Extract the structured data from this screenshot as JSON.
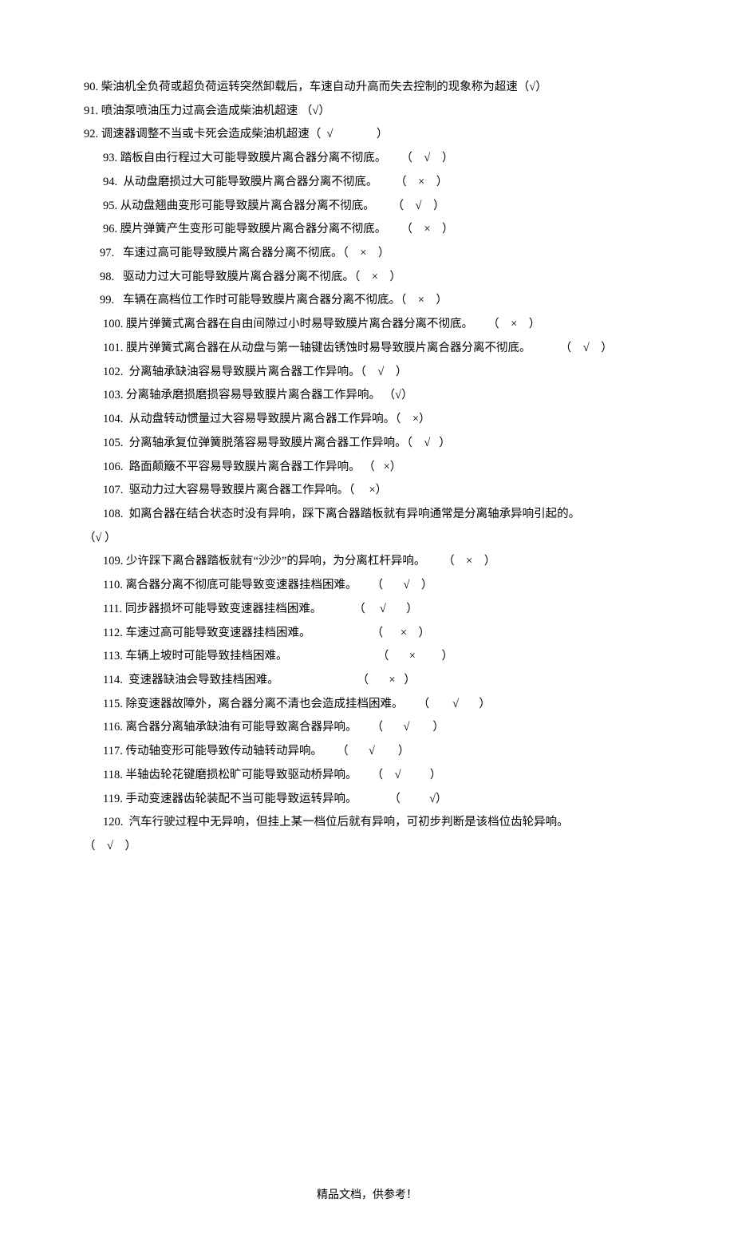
{
  "lines": [
    {
      "cls": "",
      "text": "90. 柴油机全负荷或超负荷运转突然卸载后，车速自动升高而失去控制的现象称为超速（√）"
    },
    {
      "cls": "",
      "text": "91. 喷油泵喷油压力过高会造成柴油机超速 （√）"
    },
    {
      "cls": "",
      "text": "92. 调速器调整不当或卡死会造成柴油机超速（  √               ）"
    },
    {
      "cls": "indent1",
      "text": "93. 踏板自由行程过大可能导致膜片离合器分离不彻底。     （    √    ）"
    },
    {
      "cls": "indent1",
      "text": "94.  从动盘磨损过大可能导致膜片离合器分离不彻底。      （    ×    ）"
    },
    {
      "cls": "indent1",
      "text": "95. 从动盘翘曲变形可能导致膜片离合器分离不彻底。      （    √    ）"
    },
    {
      "cls": "indent1",
      "text": "96. 膜片弹簧产生变形可能导致膜片离合器分离不彻底。     （    ×    ）"
    },
    {
      "cls": "indent2",
      "text": "97.   车速过高可能导致膜片离合器分离不彻底。（    ×    ）"
    },
    {
      "cls": "indent2",
      "text": "98.   驱动力过大可能导致膜片离合器分离不彻底。（    ×    ）"
    },
    {
      "cls": "indent2",
      "text": "99.   车辆在高档位工作时可能导致膜片离合器分离不彻底。（    ×    ）"
    },
    {
      "cls": "indent1",
      "text": "100. 膜片弹簧式离合器在自由间隙过小时易导致膜片离合器分离不彻底。     （    ×    ）"
    },
    {
      "cls": "indent1",
      "text": "101. 膜片弹簧式离合器在从动盘与第一轴键齿锈蚀时易导致膜片离合器分离不彻底。          （    √    ）"
    },
    {
      "cls": "indent1",
      "text": "102.  分离轴承缺油容易导致膜片离合器工作异响。（    √    ）"
    },
    {
      "cls": "indent1",
      "text": "103. 分离轴承磨损磨损容易导致膜片离合器工作异响。 （√）"
    },
    {
      "cls": "indent1",
      "text": "104.  从动盘转动惯量过大容易导致膜片离合器工作异响。（    ×）"
    },
    {
      "cls": "indent1",
      "text": "105.  分离轴承复位弹簧脱落容易导致膜片离合器工作异响。（    √   ）"
    },
    {
      "cls": "indent1",
      "text": "106.  路面颠簸不平容易导致膜片离合器工作异响。 （   ×）"
    },
    {
      "cls": "indent1",
      "text": "107.  驱动力过大容易导致膜片离合器工作异响。（     ×）"
    },
    {
      "cls": "indent1",
      "text": "108.  如离合器在结合状态时没有异响，踩下离合器踏板就有异响通常是分离轴承异响引起的。"
    },
    {
      "cls": "",
      "text": "（√ ）"
    },
    {
      "cls": "indent1",
      "text": "109. 少许踩下离合器踏板就有“沙沙”的异响，为分离杠杆异响。      （    ×    ）"
    },
    {
      "cls": "indent1",
      "text": "110. 离合器分离不彻底可能导致变速器挂档困难。     （       √    ）"
    },
    {
      "cls": "indent1",
      "text": "111. 同步器损坏可能导致变速器挂档困难。           （     √       ）"
    },
    {
      "cls": "indent1",
      "text": "112. 车速过高可能导致变速器挂档困难。                     （      ×    ）"
    },
    {
      "cls": "indent1",
      "text": "113. 车辆上坡时可能导致挂档困难。                               （       ×         ）"
    },
    {
      "cls": "indent1",
      "text": "114.  变速器缺油会导致挂档困难。                           （       ×   ）"
    },
    {
      "cls": "indent1",
      "text": "115. 除变速器故障外，离合器分离不清也会造成挂档困难。     （        √       ）"
    },
    {
      "cls": "indent1",
      "text": "116. 离合器分离轴承缺油有可能导致离合器异响。     （       √        ）"
    },
    {
      "cls": "indent1",
      "text": "117. 传动轴变形可能导致传动轴转动异响。     （       √        ）"
    },
    {
      "cls": "indent1",
      "text": "118. 半轴齿轮花键磨损松旷可能导致驱动桥异响。     （    √          ）"
    },
    {
      "cls": "indent1",
      "text": "119. 手动变速器齿轮装配不当可能导致运转异响。           （          √）"
    },
    {
      "cls": "indent1",
      "text": "120.  汽车行驶过程中无异响，但挂上某一档位后就有异响，可初步判断是该档位齿轮异响。"
    },
    {
      "cls": "",
      "text": "（    √    ）"
    }
  ],
  "footer": "精品文档，供参考！"
}
